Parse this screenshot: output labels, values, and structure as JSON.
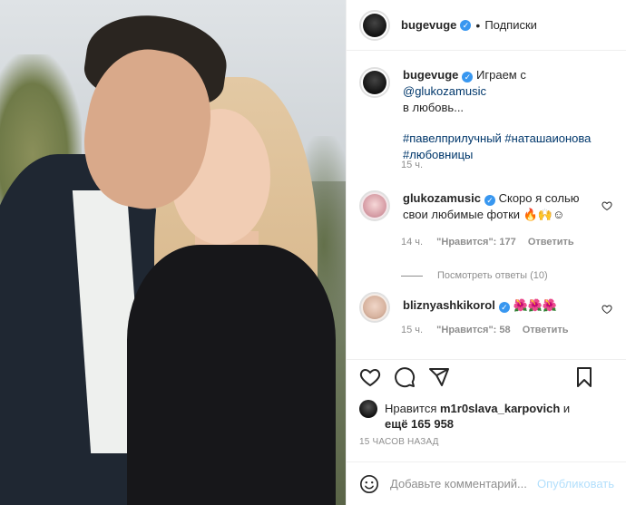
{
  "header": {
    "username": "bugevuge",
    "separator": "•",
    "follow_label": "Подписки"
  },
  "caption": {
    "username": "bugevuge",
    "text_before": "Играем с ",
    "mention": "@glukozamusic",
    "text_after": "в любовь...",
    "hashtags_line1": "#павелприлучный #наташаионова",
    "hashtags_line2": "#любовницы",
    "time": "15 ч."
  },
  "comments": [
    {
      "username": "glukozamusic",
      "text_line1": "Скоро я солью",
      "text_line2": "свои любимые фотки",
      "emoji": "🔥🙌☺",
      "time": "14 ч.",
      "likes": "\"Нравится\": 177",
      "reply": "Ответить",
      "view_replies": "Посмотреть ответы (10)"
    },
    {
      "username": "bliznyashkikorol",
      "text_line1": "🌺🌺🌺",
      "time": "15 ч.",
      "likes": "\"Нравится\": 58",
      "reply": "Ответить"
    }
  ],
  "icons": {
    "like": "heart-icon",
    "comment": "comment-icon",
    "share": "share-icon",
    "save": "bookmark-icon",
    "emoji": "smile-icon"
  },
  "likes": {
    "prefix": "Нравится",
    "liker": "m1r0slava_karpovich",
    "suffix": "и",
    "others": "ещё 165 958"
  },
  "timestamp": "15 ЧАСОВ НАЗАД",
  "add_comment": {
    "placeholder": "Добавьте комментарий...",
    "publish_label": "Опубликовать"
  },
  "colors": {
    "verified": "#3897f0",
    "link": "#00376b",
    "muted": "#8e8e8e",
    "publish_disabled": "#b2dffc"
  }
}
